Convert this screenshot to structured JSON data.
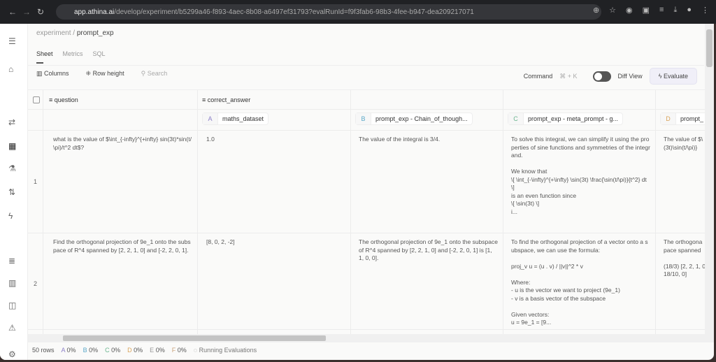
{
  "browser": {
    "url_host": "app.athina.ai",
    "url_path": "/develop/experiment/b5299a46-f893-4aec-8b08-a6497ef31793?evalRunId=f9f3fab6-98b3-4fee-b947-dea209217071"
  },
  "breadcrumb": {
    "parent": "experiment",
    "sep": "/",
    "current": "prompt_exp"
  },
  "tabs": [
    "Sheet",
    "Metrics",
    "SQL"
  ],
  "toolbar": {
    "columns": "Columns",
    "row_height": "Row height",
    "search_placeholder": "Search",
    "command": "Command",
    "shortcut": "⌘ + K",
    "diff_view": "Diff View",
    "evaluate": "Evaluate"
  },
  "headers": {
    "question": "question",
    "correct_answer": "correct_answer"
  },
  "chips": [
    {
      "letter": "A",
      "label": "maths_dataset",
      "color": "#8b7fc7"
    },
    {
      "letter": "B",
      "label": "prompt_exp - Chain_of_though...",
      "color": "#5aa8c8"
    },
    {
      "letter": "C",
      "label": "prompt_exp - meta_prompt - g...",
      "color": "#6bb58f"
    },
    {
      "letter": "D",
      "label": "prompt_",
      "color": "#d9a45a"
    }
  ],
  "rows": [
    {
      "num": "1",
      "question": "what is the value of $\\int_{-infty}^{+infty} sin(3t)*sin(t/\\pi)/t^2 dt$?",
      "a": "1.0",
      "b": "The value of the integral is 3/4.",
      "c": "To solve this integral, we can simplify it using the properties of sine functions and symmetries of the integrand.\n\nWe know that\n\\[ \\int_{-\\infty}^{+\\infty} \\sin(3t) \\frac{\\sin(t/\\pi)}{t^2} dt \\]\nis an even function since\n\\[ \\sin(3t) \\]\ni...",
      "d": "The value of $\\(3t)\\sin(t/\\pi)}"
    },
    {
      "num": "2",
      "question": "Find the orthogonal projection of 9e_1 onto the subspace of R^4 spanned by [2, 2, 1, 0] and [-2, 2, 0, 1].",
      "a": "[8, 0, 2, -2]",
      "b": "The orthogonal projection of 9e_1 onto the subspace of R^4 spanned by [2, 2, 1, 0] and [-2, 2, 0, 1] is [1, 1, 0, 0].",
      "c": "To find the orthogonal projection of a vector onto a subspace, we can use the formula:\n\nproj_v u = (u . v) / ||v||^2 * v\n\nWhere:\n- u is the vector we want to project (9e_1)\n- v is a basis vector of the subspace\n\nGiven vectors:\nu = 9e_1 = [9...",
      "d": "The orthogona pace spanned\n\n(18/3) [2, 2, 1, 0 18/10, 0]"
    }
  ],
  "footer": {
    "rows": "50 rows",
    "stats": [
      {
        "letter": "A",
        "value": "0%"
      },
      {
        "letter": "B",
        "value": "0%"
      },
      {
        "letter": "C",
        "value": "0%"
      },
      {
        "letter": "D",
        "value": "0%"
      },
      {
        "letter": "E",
        "value": "0%"
      },
      {
        "letter": "F",
        "value": "0%"
      }
    ],
    "status": "Running Evaluations"
  }
}
